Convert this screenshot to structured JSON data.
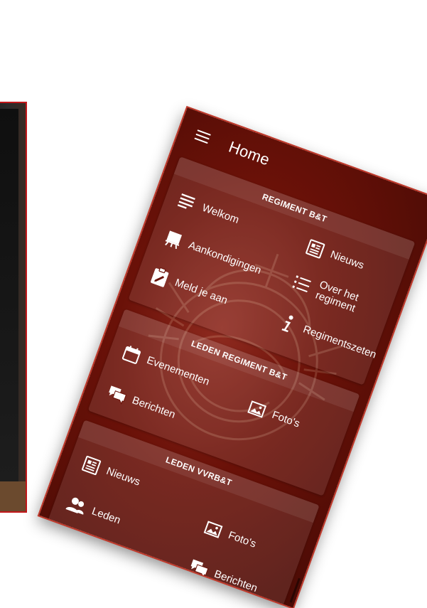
{
  "app": {
    "title": "Home"
  },
  "sections": [
    {
      "header": "REGIMENT B&T",
      "items": [
        {
          "label": "Welkom",
          "icon": "list-lines-icon"
        },
        {
          "label": "Nieuws",
          "icon": "newspaper-icon"
        },
        {
          "label": "Aankondigingen",
          "icon": "presentation-board-icon"
        },
        {
          "label": "Over het regiment",
          "icon": "bulleted-list-icon"
        },
        {
          "label": "Meld je aan",
          "icon": "clipboard-edit-icon"
        },
        {
          "label": "Regimentszeten",
          "icon": "info-icon"
        }
      ]
    },
    {
      "header": "LEDEN REGIMENT B&T",
      "items": [
        {
          "label": "Evenementen",
          "icon": "calendar-icon"
        },
        {
          "label": "Foto's",
          "icon": "photo-icon"
        },
        {
          "label": "Berichten",
          "icon": "chat-bubbles-icon"
        }
      ]
    },
    {
      "header": "LEDEN VVRB&T",
      "items": [
        {
          "label": "Nieuws",
          "icon": "newspaper-icon"
        },
        {
          "label": "Foto's",
          "icon": "photo-icon"
        },
        {
          "label": "Leden",
          "icon": "people-icon"
        },
        {
          "label": "Berichten",
          "icon": "chat-bubbles-icon"
        }
      ]
    }
  ],
  "colors": {
    "brand": "#6a1108",
    "border": "#c0392b",
    "text": "#ffffff"
  }
}
